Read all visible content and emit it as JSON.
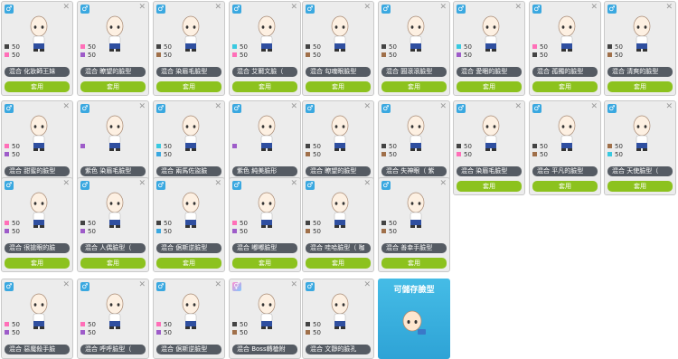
{
  "button_label": "套用",
  "promo_title": "可儲存臉型",
  "colors": {
    "button": "#8cc21e",
    "name_bar": "#555b63",
    "promo_bg": "#2ea3d6",
    "card_bg": "#ececec"
  },
  "cards": [
    {
      "gender_icon": "male-icon",
      "swatches": [
        {
          "color": "#444444",
          "value": "50"
        },
        {
          "color": "#ff6fb8",
          "value": "50"
        }
      ],
      "label": "混合 化妝師王妹"
    },
    {
      "gender_icon": "male-icon",
      "swatches": [
        {
          "color": "#ff6fb8",
          "value": "50"
        },
        {
          "color": "#9e5cc9",
          "value": "50"
        }
      ],
      "label": "混合 瞭望的臉型"
    },
    {
      "gender_icon": "male-icon",
      "swatches": [
        {
          "color": "#444444",
          "value": "50"
        },
        {
          "color": "#a0704a",
          "value": "50"
        }
      ],
      "label": "混合 染眉毛臉型"
    },
    {
      "gender_icon": "male-icon",
      "swatches": [
        {
          "color": "#39c9e0",
          "value": "50"
        },
        {
          "color": "#ff6fb8",
          "value": "50"
        }
      ],
      "label": "混合 艾爾文臉（"
    },
    {
      "gender_icon": "male-icon",
      "swatches": [
        {
          "color": "#444444",
          "value": "50"
        },
        {
          "color": "#a0704a",
          "value": "50"
        }
      ],
      "label": "混合 勾魂眼臉型"
    },
    {
      "gender_icon": "male-icon",
      "swatches": [
        {
          "color": "#444444",
          "value": "50"
        },
        {
          "color": "#a0704a",
          "value": "50"
        }
      ],
      "label": "混合 圓滾滾臉型"
    },
    {
      "gender_icon": "male-icon",
      "swatches": [
        {
          "color": "#39c9e0",
          "value": "50"
        },
        {
          "color": "#9e5cc9",
          "value": "50"
        }
      ],
      "label": "混合 愛睏的臉型"
    },
    {
      "gender_icon": "male-icon",
      "swatches": [
        {
          "color": "#ff6fb8",
          "value": "50"
        },
        {
          "color": "#444444",
          "value": "50"
        }
      ],
      "label": "混合 孤獨的臉型"
    },
    {
      "gender_icon": "male-icon",
      "swatches": [
        {
          "color": "#444444",
          "value": "50"
        },
        {
          "color": "#a0704a",
          "value": "50"
        }
      ],
      "label": "混合 清爽的臉型"
    },
    {
      "gender_icon": "male-icon",
      "swatches": [
        {
          "color": "#ff6fb8",
          "value": "50"
        },
        {
          "color": "#9e5cc9",
          "value": "50"
        }
      ],
      "label": "混合 甜蜜的臉型"
    },
    {
      "gender_icon": "male-icon",
      "swatches": [
        {
          "color": "#9e5cc9",
          "value": ""
        }
      ],
      "label": "紫色 染眉毛臉型"
    },
    {
      "gender_icon": "male-icon",
      "swatches": [
        {
          "color": "#39c9e0",
          "value": "50"
        },
        {
          "color": "#3aa8e0",
          "value": "50"
        }
      ],
      "label": "混合 兩馬佐盜臉"
    },
    {
      "gender_icon": "male-icon",
      "swatches": [
        {
          "color": "#9e5cc9",
          "value": ""
        }
      ],
      "label": "紫色 純美臉形"
    },
    {
      "gender_icon": "male-icon",
      "swatches": [
        {
          "color": "#444444",
          "value": "50"
        },
        {
          "color": "#a0704a",
          "value": "50"
        }
      ],
      "label": "混合 瞭望的臉型"
    },
    {
      "gender_icon": "male-icon",
      "swatches": [
        {
          "color": "#444444",
          "value": "50"
        },
        {
          "color": "#a0704a",
          "value": "50"
        }
      ],
      "label": "混合 失神眼（ 紫"
    },
    {
      "gender_icon": "male-icon",
      "swatches": [
        {
          "color": "#444444",
          "value": "50"
        },
        {
          "color": "#ff6fb8",
          "value": "50"
        }
      ],
      "label": "混合 染眉毛臉型"
    },
    {
      "gender_icon": "male-icon",
      "swatches": [
        {
          "color": "#444444",
          "value": "50"
        },
        {
          "color": "#a0704a",
          "value": "50"
        }
      ],
      "label": "混合 平凡的臉型"
    },
    {
      "gender_icon": "male-icon",
      "swatches": [
        {
          "color": "#a0704a",
          "value": "50"
        },
        {
          "color": "#39c9e0",
          "value": "50"
        }
      ],
      "label": "混合 天使臉型（"
    },
    {
      "gender_icon": "male-icon",
      "swatches": [
        {
          "color": "#ff6fb8",
          "value": "50"
        },
        {
          "color": "#9e5cc9",
          "value": "50"
        }
      ],
      "label": "混合 很搶眼的臉"
    },
    {
      "gender_icon": "male-icon",
      "swatches": [
        {
          "color": "#444444",
          "value": "50"
        },
        {
          "color": "#9e5cc9",
          "value": "50"
        }
      ],
      "label": "混合 人偶臉型（"
    },
    {
      "gender_icon": "male-icon",
      "swatches": [
        {
          "color": "#444444",
          "value": "50"
        },
        {
          "color": "#3aa8e0",
          "value": "50"
        }
      ],
      "label": "混合 倨斯逆臉型"
    },
    {
      "gender_icon": "male-icon",
      "swatches": [
        {
          "color": "#ff6fb8",
          "value": "50"
        },
        {
          "color": "#9e5cc9",
          "value": "50"
        }
      ],
      "label": "混合 嘟嘟臉型"
    },
    {
      "gender_icon": "male-icon",
      "swatches": [
        {
          "color": "#444444",
          "value": "50"
        },
        {
          "color": "#a0704a",
          "value": "50"
        }
      ],
      "label": "混合 哇哈臉型（ 咖"
    },
    {
      "gender_icon": "male-icon",
      "swatches": [
        {
          "color": "#444444",
          "value": "50"
        },
        {
          "color": "#a0704a",
          "value": "50"
        }
      ],
      "label": "混合 善幸手臉型"
    },
    {
      "gender_icon": "male-icon",
      "swatches": [
        {
          "color": "#ff6fb8",
          "value": "50"
        },
        {
          "color": "#9e5cc9",
          "value": "50"
        }
      ],
      "label": "混合 惡魔殺手臉"
    },
    {
      "gender_icon": "male-icon",
      "swatches": [
        {
          "color": "#ff6fb8",
          "value": "50"
        },
        {
          "color": "#9e5cc9",
          "value": "50"
        }
      ],
      "label": "混合 呼呼臉型（"
    },
    {
      "gender_icon": "male-icon",
      "swatches": [
        {
          "color": "#ff6fb8",
          "value": "50"
        },
        {
          "color": "#9e5cc9",
          "value": "50"
        }
      ],
      "label": "混合 倨斯逆臉型"
    },
    {
      "gender_icon": "unisex-icon",
      "swatches": [
        {
          "color": "#444444",
          "value": "50"
        },
        {
          "color": "#a0704a",
          "value": "50"
        }
      ],
      "label": "混合 Boss轉槍附"
    },
    {
      "gender_icon": "male-icon",
      "swatches": [
        {
          "color": "#444444",
          "value": "50"
        },
        {
          "color": "#a0704a",
          "value": "50"
        }
      ],
      "label": "混合 文靜的臉孔"
    }
  ]
}
